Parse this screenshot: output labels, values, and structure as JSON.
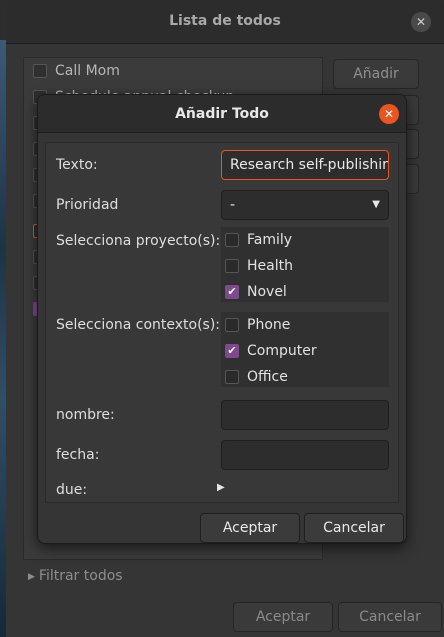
{
  "main_window": {
    "title": "Lista de todos",
    "close_glyph": "✕",
    "todos": [
      {
        "label": "Call Mom",
        "state": "unchecked"
      },
      {
        "label": "Schedule annual checkup",
        "state": "unchecked"
      },
      {
        "label": "",
        "state": "unchecked"
      },
      {
        "label": "",
        "state": "unchecked"
      },
      {
        "label": "",
        "state": "unchecked"
      },
      {
        "label": "",
        "state": "unchecked"
      },
      {
        "label": "",
        "state": "focused"
      },
      {
        "label": "",
        "state": "unchecked"
      },
      {
        "label": "",
        "state": "unchecked"
      },
      {
        "label": "",
        "state": "checked"
      }
    ],
    "side_buttons": {
      "add": "Añadir"
    },
    "filter_expander": "Filtrar todos",
    "buttons": {
      "accept": "Aceptar",
      "cancel": "Cancelar"
    }
  },
  "dialog": {
    "title": "Añadir Todo",
    "close_glyph": "✕",
    "fields": {
      "texto": {
        "label": "Texto:",
        "value": "Research self-publishir"
      },
      "prioridad": {
        "label": "Prioridad",
        "value": "-"
      },
      "proyecto": {
        "label": "Selecciona proyecto(s):",
        "options": [
          {
            "label": "Family",
            "checked": false
          },
          {
            "label": "Health",
            "checked": false
          },
          {
            "label": "Novel",
            "checked": true
          }
        ]
      },
      "contexto": {
        "label": "Selecciona contexto(s):",
        "options": [
          {
            "label": "Phone",
            "checked": false
          },
          {
            "label": "Computer",
            "checked": true
          },
          {
            "label": "Office",
            "checked": false
          }
        ]
      },
      "nombre": {
        "label": "nombre:",
        "value": ""
      },
      "fecha": {
        "label": "fecha:",
        "value": ""
      },
      "due": {
        "label": "due:"
      }
    },
    "buttons": {
      "accept": "Aceptar",
      "cancel": "Cancelar"
    }
  },
  "colors": {
    "accent_orange": "#e95420",
    "check_purple": "#7d4a8d",
    "window_bg": "#353535",
    "titlebar_bg": "#2c2c2c"
  },
  "icons": {
    "dropdown": "dropdown-arrow-icon",
    "expander": "expander-triangle-icon",
    "check": "checkmark-icon",
    "close": "close-icon"
  }
}
